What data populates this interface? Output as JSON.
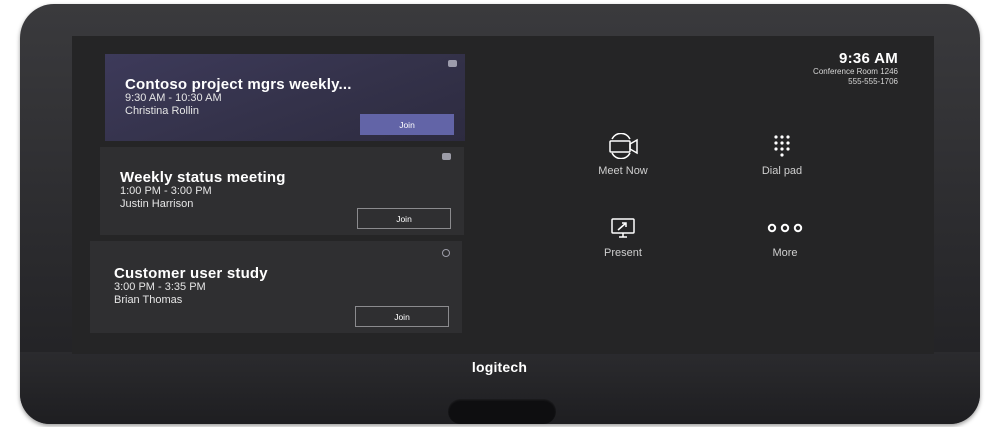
{
  "device": {
    "brand": "logitech"
  },
  "status": {
    "time": "9:36 AM",
    "room": "Conference Room 1246",
    "phone": "555-555-1706"
  },
  "meetings": [
    {
      "title": "Contoso project mgrs weekly...",
      "time": "9:30 AM - 10:30 AM",
      "organizer": "Christina Rollin",
      "join_label": "Join",
      "app_icon": "teams-icon"
    },
    {
      "title": "Weekly status meeting",
      "time": "1:00 PM - 3:00 PM",
      "organizer": "Justin Harrison",
      "join_label": "Join",
      "app_icon": "teams-icon"
    },
    {
      "title": "Customer user study",
      "time": "3:00 PM - 3:35 PM",
      "organizer": "Brian Thomas",
      "join_label": "Join",
      "app_icon": "skype-icon"
    }
  ],
  "actions": [
    {
      "label": "Meet Now",
      "icon": "video-camera-icon"
    },
    {
      "label": "Dial pad",
      "icon": "dialpad-icon"
    },
    {
      "label": "Present",
      "icon": "present-screen-icon"
    },
    {
      "label": "More",
      "icon": "more-dots-icon"
    }
  ],
  "colors": {
    "accent": "#6264a7",
    "screen_bg": "#252526",
    "card_bg": "#2f2f31",
    "device_body": "#2a2a2d"
  }
}
